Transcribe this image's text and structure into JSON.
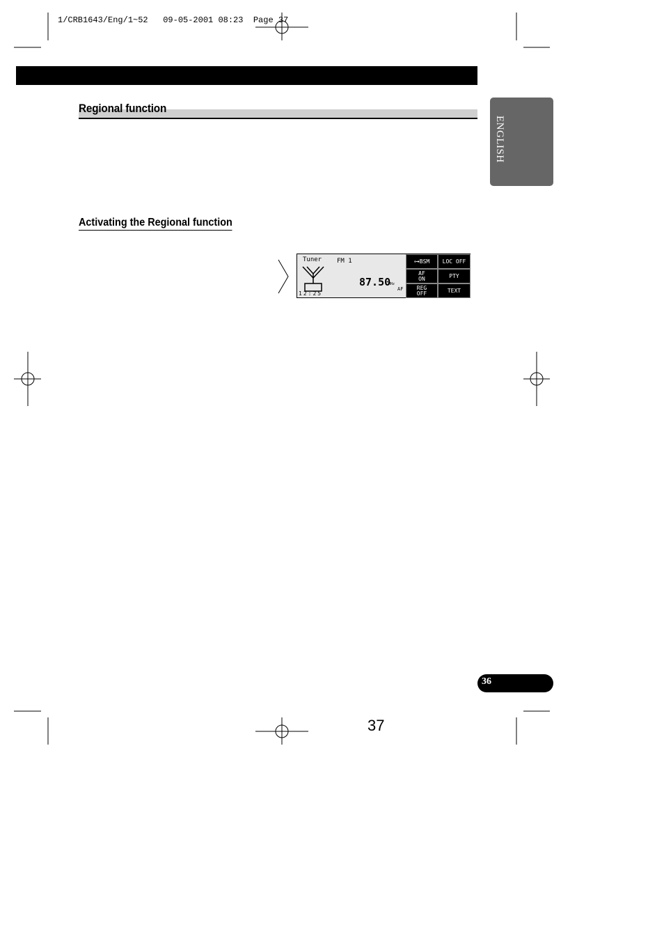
{
  "slug": "1/CRB1643/Eng/1~52   09-05-2001 08:23  Page 37",
  "section_title": "Regional function",
  "subsection_title": "Activating the Regional function",
  "language_tab": "ENGLISH",
  "display": {
    "source": "Tuner",
    "band": "FM 1",
    "frequency": "87.50",
    "unit": "MHz",
    "af": "AF",
    "clock": "12:25",
    "buttons": [
      "BSM",
      "LOC OFF",
      "AF ON",
      "PTY",
      "REG OFF",
      "TEXT"
    ]
  },
  "page_badge": "36",
  "page_number": "37"
}
